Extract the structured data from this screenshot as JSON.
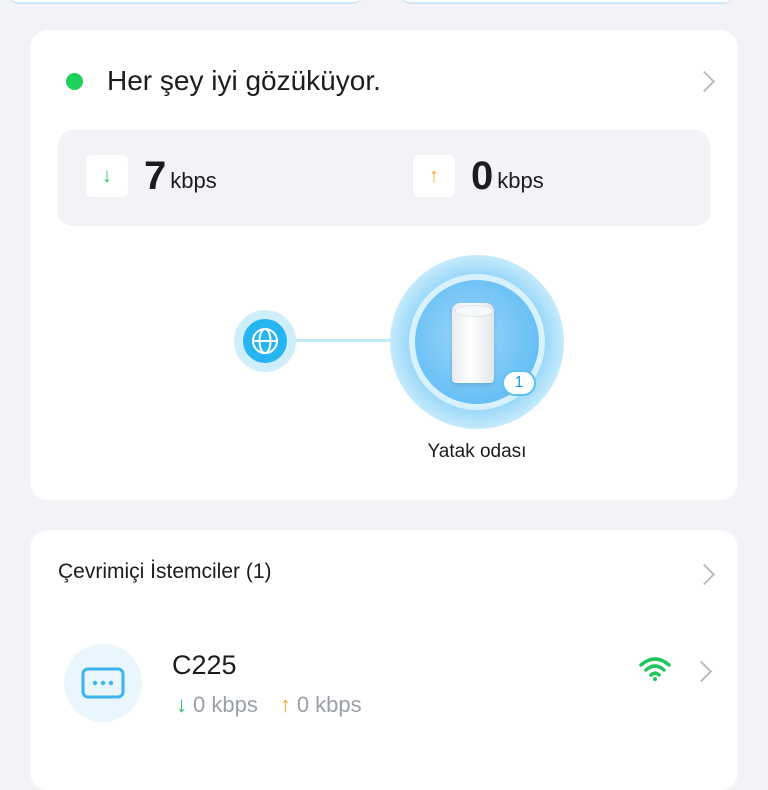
{
  "status": {
    "message": "Her şey iyi gözüküyor."
  },
  "speed": {
    "download_value": "7",
    "download_unit": "kbps",
    "upload_value": "0",
    "upload_unit": "kbps"
  },
  "topology": {
    "router_label": "Yatak odası",
    "router_client_count": "1"
  },
  "clients": {
    "title": "Çevrimiçi İstemciler (1)",
    "items": [
      {
        "name": "C225",
        "download": "0 kbps",
        "upload": "0 kbps",
        "signal": "wifi-strong"
      }
    ]
  },
  "colors": {
    "status_ok": "#1fd05a",
    "download_arrow": "#22c55e",
    "upload_arrow": "#f5a623",
    "accent": "#27b5f1",
    "wifi": "#22c55e"
  }
}
